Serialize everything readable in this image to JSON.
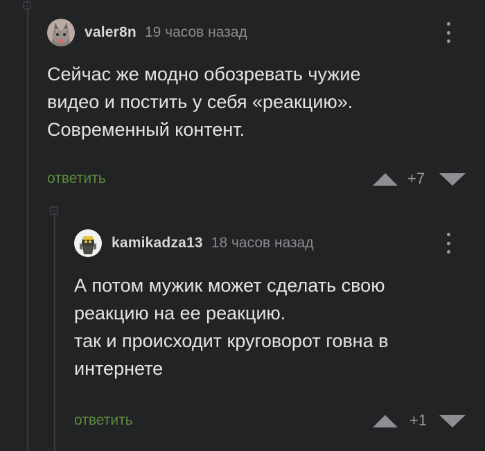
{
  "comments": [
    {
      "username": "valer8n",
      "timestamp": "19 часов назад",
      "avatar_icon": "cat-avatar",
      "body_lines": [
        "Сейчас же модно обозревать чужие",
        "видео и постить у себя «реакцию».",
        "Современный контент."
      ],
      "reply_label": "ответить",
      "score": "+7"
    },
    {
      "username": "kamikadza13",
      "timestamp": "18 часов назад",
      "avatar_icon": "robot-avatar",
      "body_lines": [
        "А потом мужик может сделать свою",
        "реакцию на ее реакцию.",
        "так и происходит круговорот говна в",
        "интернете"
      ],
      "reply_label": "ответить",
      "score": "+1"
    }
  ],
  "colors": {
    "background": "#222325",
    "reply_link": "#5b8b3c",
    "thread_line": "#3a3b3e",
    "vote_arrow": "#8e8f92"
  }
}
